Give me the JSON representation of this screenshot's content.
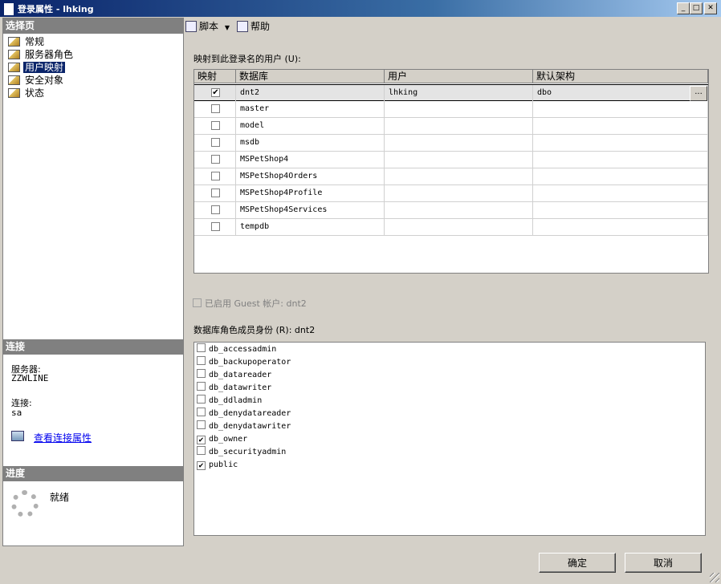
{
  "window": {
    "title": "登录属性 - lhking"
  },
  "left_panel": {
    "select_page_header": "选择页",
    "nav_items": [
      "常规",
      "服务器角色",
      "用户映射",
      "安全对象",
      "状态"
    ],
    "selected_index": 2,
    "connection_header": "连接",
    "server_label": "服务器:",
    "server_value": "ZZWLINE",
    "connection_label": "连接:",
    "connection_value": "sa",
    "view_connection_link": "查看连接属性",
    "progress_header": "进度",
    "progress_status": "就绪"
  },
  "toolbar": {
    "script_label": "脚本",
    "help_label": "帮助"
  },
  "mapping": {
    "label": "映射到此登录名的用户 (U):",
    "columns": [
      "映射",
      "数据库",
      "用户",
      "默认架构"
    ],
    "rows": [
      {
        "mapped": true,
        "database": "dnt2",
        "user": "lhking",
        "schema": "dbo",
        "selected": true
      },
      {
        "mapped": false,
        "database": "master",
        "user": "",
        "schema": ""
      },
      {
        "mapped": false,
        "database": "model",
        "user": "",
        "schema": ""
      },
      {
        "mapped": false,
        "database": "msdb",
        "user": "",
        "schema": ""
      },
      {
        "mapped": false,
        "database": "MSPetShop4",
        "user": "",
        "schema": ""
      },
      {
        "mapped": false,
        "database": "MSPetShop4Orders",
        "user": "",
        "schema": ""
      },
      {
        "mapped": false,
        "database": "MSPetShop4Profile",
        "user": "",
        "schema": ""
      },
      {
        "mapped": false,
        "database": "MSPetShop4Services",
        "user": "",
        "schema": ""
      },
      {
        "mapped": false,
        "database": "tempdb",
        "user": "",
        "schema": ""
      }
    ],
    "ellipsis": "..."
  },
  "guest": {
    "label": "已启用 Guest 帐户: dnt2",
    "checked": false
  },
  "roles": {
    "label": "数据库角色成员身份 (R): dnt2",
    "items": [
      {
        "name": "db_accessadmin",
        "checked": false
      },
      {
        "name": "db_backupoperator",
        "checked": false
      },
      {
        "name": "db_datareader",
        "checked": false
      },
      {
        "name": "db_datawriter",
        "checked": false
      },
      {
        "name": "db_ddladmin",
        "checked": false
      },
      {
        "name": "db_denydatareader",
        "checked": false
      },
      {
        "name": "db_denydatawriter",
        "checked": false
      },
      {
        "name": "db_owner",
        "checked": true
      },
      {
        "name": "db_securityadmin",
        "checked": false
      },
      {
        "name": "public",
        "checked": true
      }
    ]
  },
  "buttons": {
    "ok": "确定",
    "cancel": "取消"
  }
}
